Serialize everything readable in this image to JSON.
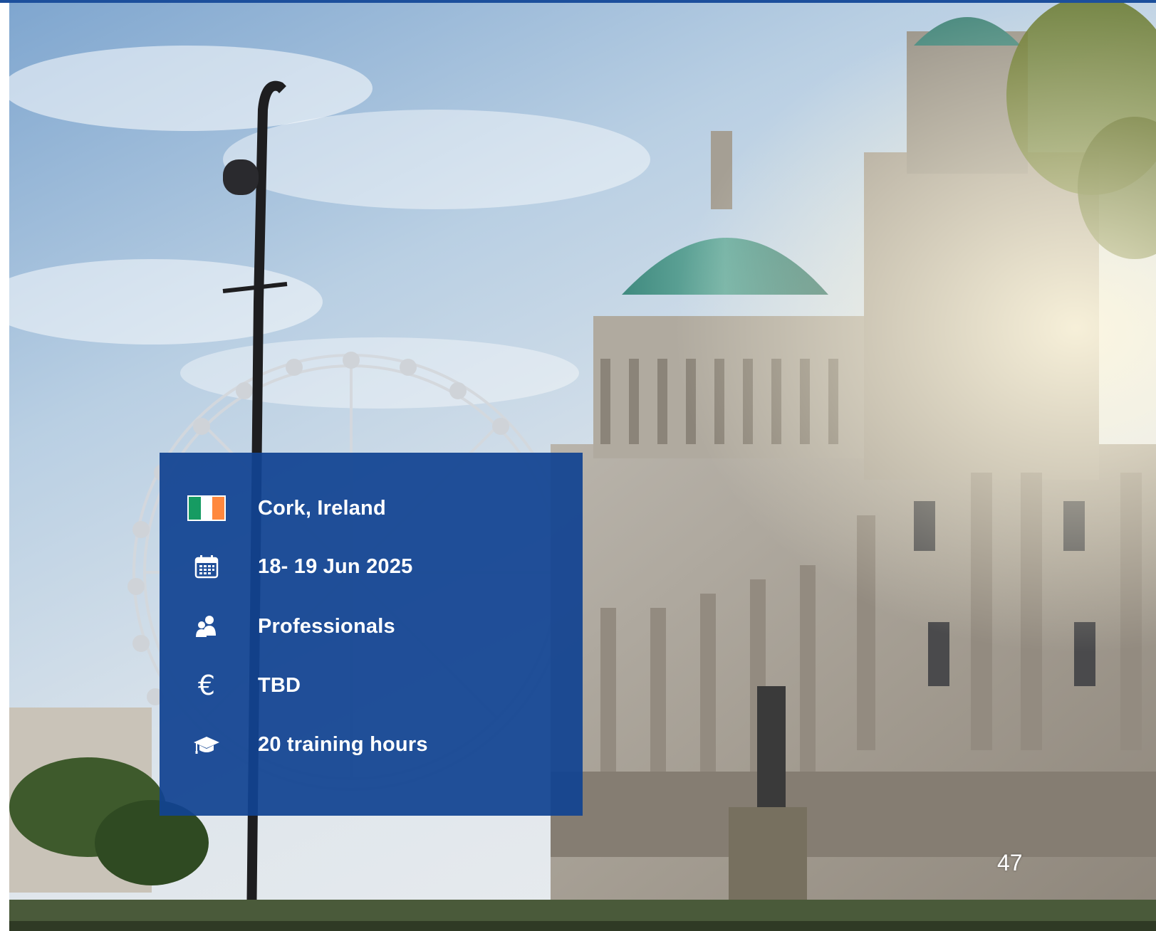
{
  "card": {
    "location": "Cork, Ireland",
    "dates": "18- 19 Jun 2025",
    "audience": "Professionals",
    "price": "TBD",
    "training": "20 training hours",
    "euro_symbol": "€"
  },
  "page_number": "47",
  "icons": {
    "location": "ireland-flag-icon",
    "dates": "calendar-icon",
    "audience": "people-icon",
    "price": "euro-icon",
    "training": "graduation-cap-icon"
  },
  "colors": {
    "card_background": "#114391",
    "top_bar": "#1c4f9c",
    "flag_green": "#169b62",
    "flag_white": "#ffffff",
    "flag_orange": "#ff883e",
    "text": "#ffffff"
  }
}
